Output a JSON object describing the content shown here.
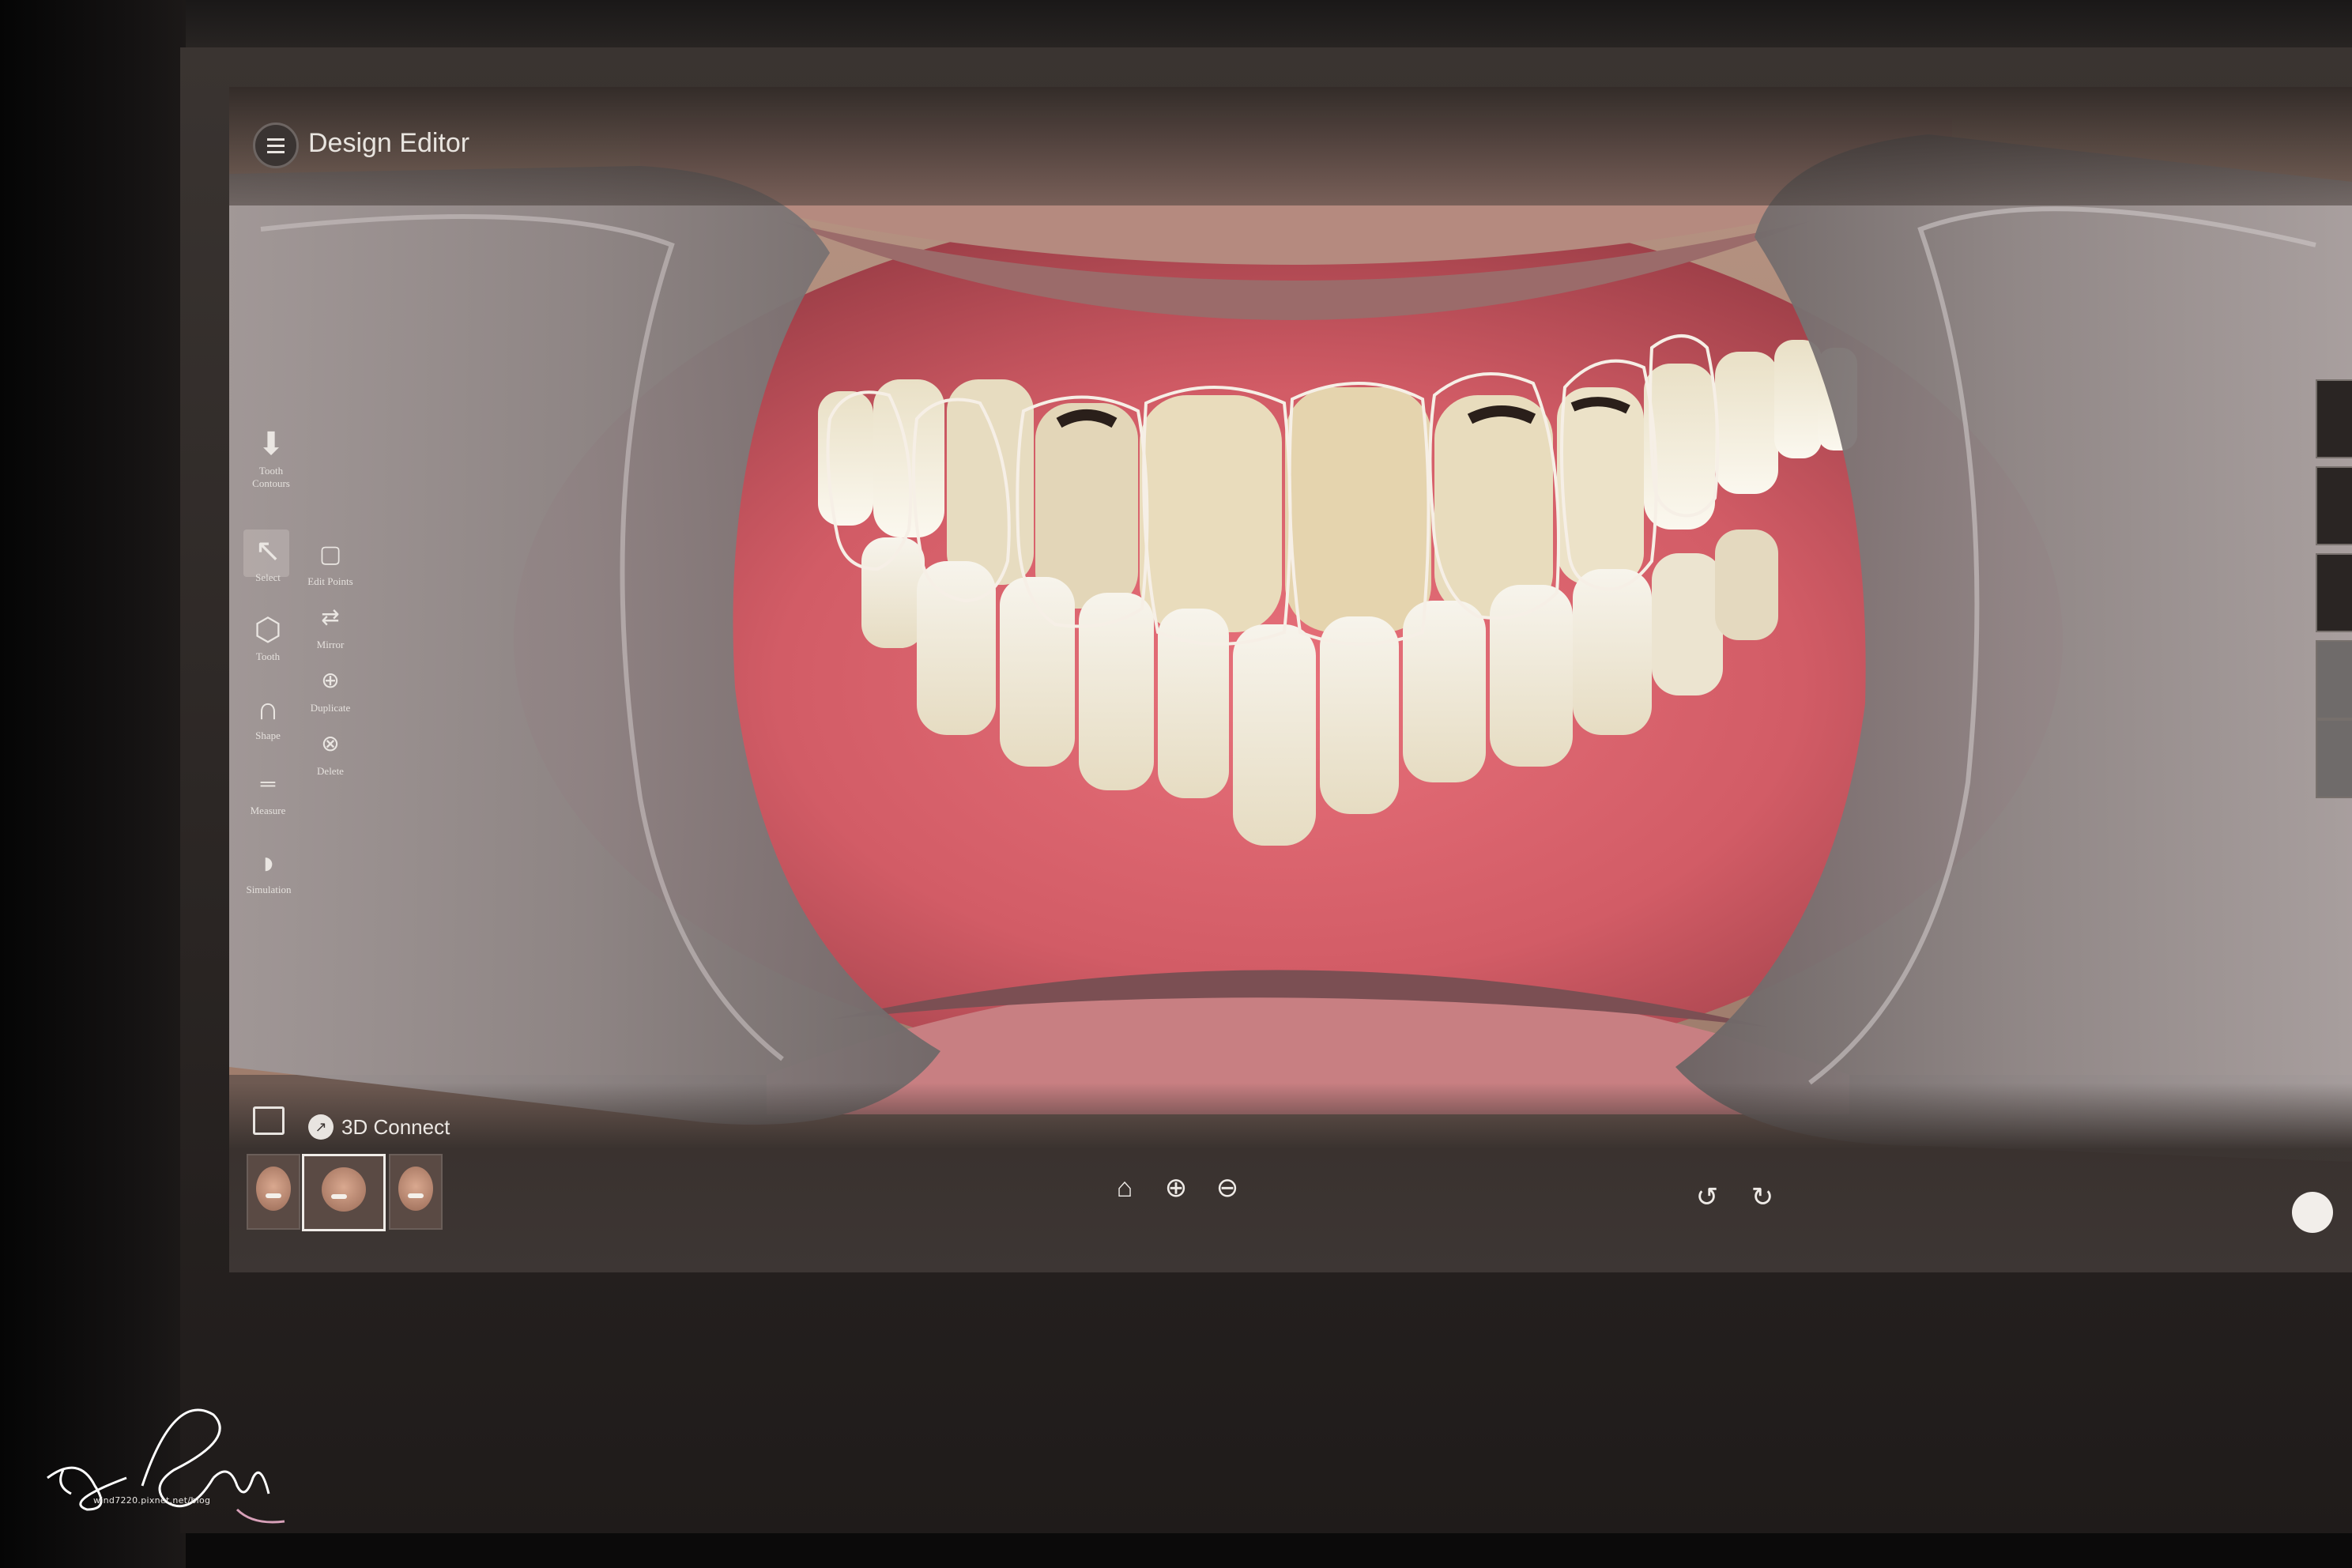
{
  "app": {
    "title": "Design Editor",
    "accent_color": "#e8e4df"
  },
  "left_toolbar": {
    "tooth_contours": "Tooth Contours",
    "select": "Select",
    "tooth": "Tooth",
    "shape": "Shape",
    "measure": "Measure",
    "simulation": "Simulation",
    "edit_points": "Edit Points",
    "mirror": "Mirror",
    "duplicate": "Duplicate",
    "delete": "Delete"
  },
  "bottom_bar": {
    "connect_label": "3D Connect",
    "photos": [
      "photo-1",
      "photo-2",
      "photo-3"
    ],
    "selected_photo_index": 1
  },
  "icons": {
    "menu": "menu-icon",
    "zoom_home": "zoom-fit-icon",
    "zoom_in": "zoom-in-icon",
    "zoom_out": "zoom-out-icon",
    "undo": "undo-icon",
    "redo": "redo-icon",
    "folder": "folder-icon"
  },
  "watermark": {
    "url": "wind7220.pixnet.net/blog"
  }
}
